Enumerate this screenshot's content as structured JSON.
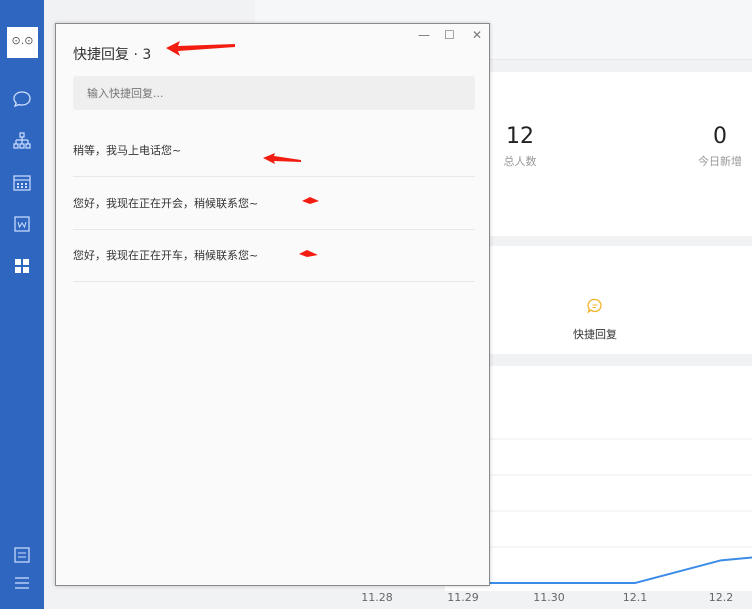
{
  "sidebar": {
    "logo": "⊙.⊙",
    "items": [
      "chat-icon",
      "org-icon",
      "calendar-icon",
      "word-icon",
      "apps-icon"
    ],
    "bottom": [
      "settings-icon",
      "menu-icon"
    ]
  },
  "stats": [
    {
      "value": "12",
      "label": "总人数"
    },
    {
      "value": "0",
      "label": "今日新增"
    }
  ],
  "shortcut": {
    "label": "快捷回复",
    "color": "#f0b429"
  },
  "dialog": {
    "title": "快捷回复 · 3",
    "controls": {
      "minimize": "—",
      "maximize": "☐",
      "close": "✕"
    },
    "search_placeholder": "输入快捷回复...",
    "items": [
      "稍等，我马上电话您~",
      "您好，我现在正在开会，稍候联系您~",
      "您好，我现在正在开车，稍候联系您~"
    ]
  },
  "chart_data": {
    "type": "line",
    "categories": [
      "11.28",
      "11.29",
      "11.30",
      "12.1",
      "12.2"
    ],
    "values": [
      0,
      0,
      0,
      0,
      0.7
    ],
    "color": "#3b8be8"
  }
}
